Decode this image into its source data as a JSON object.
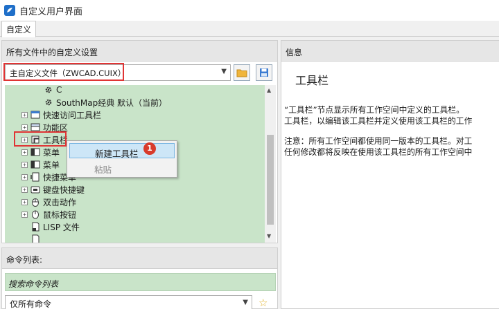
{
  "window": {
    "title": "自定义用户界面"
  },
  "tabs": [
    {
      "label": "自定义"
    }
  ],
  "left_panel": {
    "header": "所有文件中的自定义设置",
    "cuix_file": {
      "value": "主自定义文件（ZWCAD.CUIX）"
    },
    "tree": {
      "items": [
        {
          "label": "C",
          "icon": "gear-icon"
        },
        {
          "label": "SouthMap经典 默认（当前）",
          "icon": "gear-icon"
        },
        {
          "label": "快速访问工具栏",
          "icon": "quick-access-toolbar-icon"
        },
        {
          "label": "功能区",
          "icon": "ribbon-icon"
        },
        {
          "label": "工具栏",
          "icon": "toolbar-icon"
        },
        {
          "label": "菜单",
          "icon": "menu-icon"
        },
        {
          "label": "菜单",
          "icon": "menu-icon"
        },
        {
          "label": "快捷菜单",
          "icon": "shortcut-menu-icon"
        },
        {
          "label": "键盘快捷键",
          "icon": "keyboard-icon"
        },
        {
          "label": "双击动作",
          "icon": "double-click-icon"
        },
        {
          "label": "鼠标按钮",
          "icon": "mouse-icon"
        },
        {
          "label": "LISP  文件",
          "icon": "lisp-file-icon"
        }
      ]
    },
    "context_menu": {
      "items": [
        {
          "label": "新建工具栏"
        },
        {
          "label": "粘贴"
        }
      ],
      "step_badge": "1"
    }
  },
  "command_panel": {
    "header": "命令列表:",
    "search_placeholder": "搜索命令列表",
    "filter": {
      "value": "仅所有命令"
    }
  },
  "info_panel": {
    "header": "信息",
    "title": "工具栏",
    "paragraph1_line1": "“工具栏”节点显示所有工作空间中定义的工具栏。",
    "paragraph1_line2": "工具栏，以编辑该工具栏并定义使用该工具栏的工作",
    "paragraph2_line1": "注意：所有工作空间都使用同一版本的工具栏。对工",
    "paragraph2_line2": "任何修改都将反映在使用该工具栏的所有工作空间中"
  },
  "colors": {
    "tree_background": "#c9e4c9",
    "highlight_red": "#e03434",
    "menu_active": "#cde6f7",
    "badge_red": "#d83b2c",
    "app_icon_blue": "#1f6fc9"
  }
}
